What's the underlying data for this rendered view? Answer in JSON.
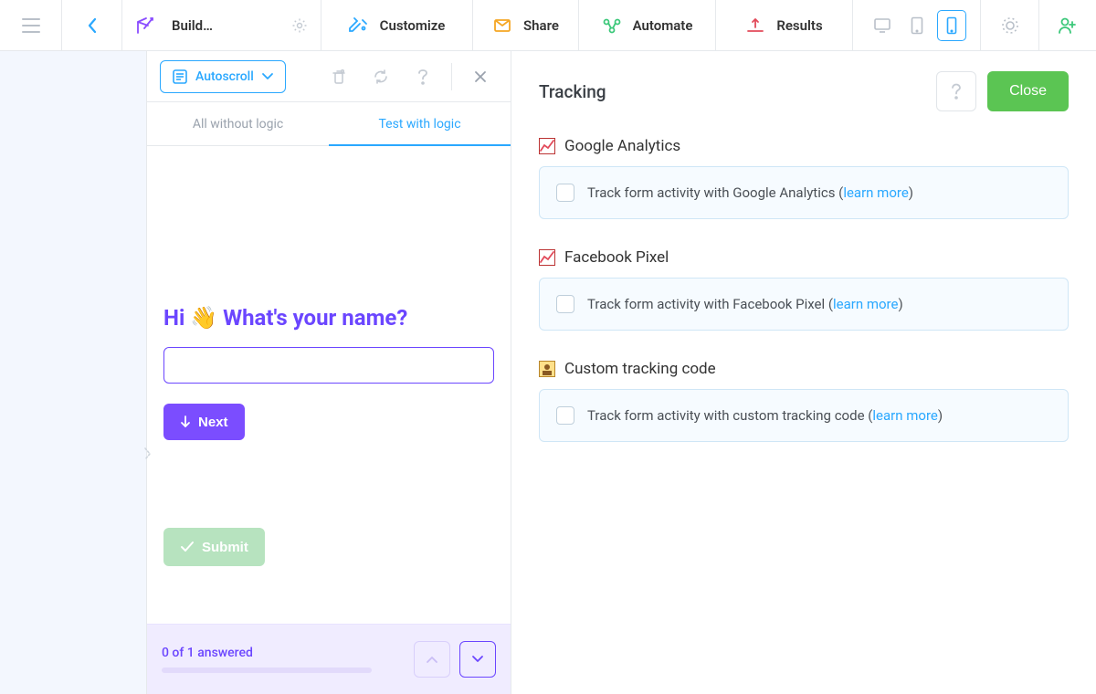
{
  "topbar": {
    "build_label": "Build…",
    "tabs": {
      "customize": "Customize",
      "share": "Share",
      "automate": "Automate",
      "results": "Results"
    }
  },
  "preview": {
    "autoscroll": "Autoscroll",
    "tab_all": "All without logic",
    "tab_test": "Test with logic",
    "question": "Hi 👋 What's your name?",
    "next": "Next",
    "submit": "Submit",
    "progress": "0 of 1 answered"
  },
  "panel": {
    "title": "Tracking",
    "close": "Close",
    "sections": [
      {
        "heading": "Google Analytics",
        "text_before": "Track form activity with Google Analytics (",
        "link": "learn more",
        "text_after": ")"
      },
      {
        "heading": "Facebook Pixel",
        "text_before": "Track form activity with Facebook Pixel (",
        "link": "learn more",
        "text_after": ")"
      },
      {
        "heading": "Custom tracking code",
        "text_before": "Track form activity with custom tracking code (",
        "link": "learn more",
        "text_after": ")"
      }
    ]
  }
}
